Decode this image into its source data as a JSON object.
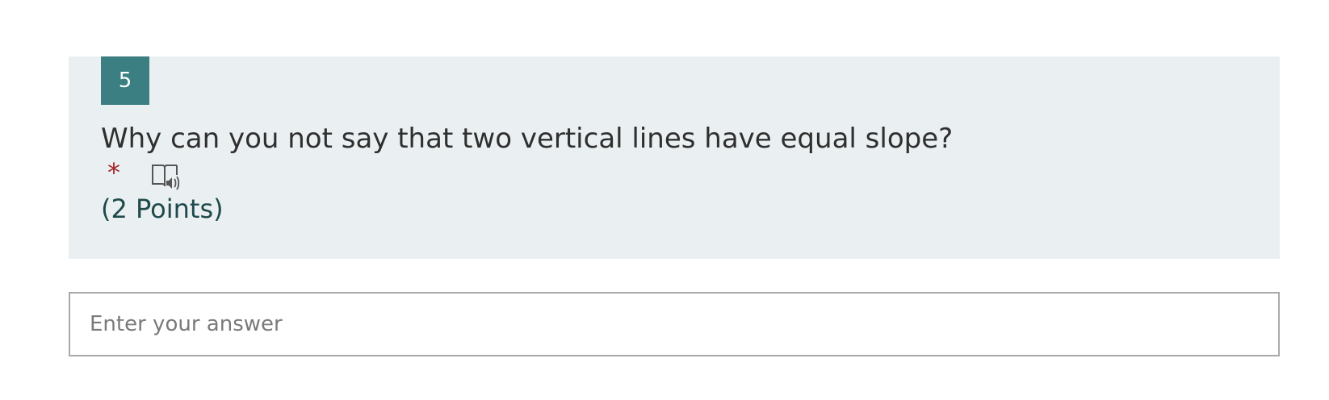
{
  "question": {
    "number": "5",
    "title": "Why can you not say that two vertical lines have equal slope?",
    "required_marker": "*",
    "points": "(2 Points)",
    "reader_icon": "immersive-reader-icon"
  },
  "answer": {
    "placeholder": "Enter your answer",
    "value": ""
  },
  "colors": {
    "card_background": "#eaf0f1",
    "number_badge": "#3b7f82",
    "required": "#a4262c",
    "points_text": "#1f4a4c"
  }
}
